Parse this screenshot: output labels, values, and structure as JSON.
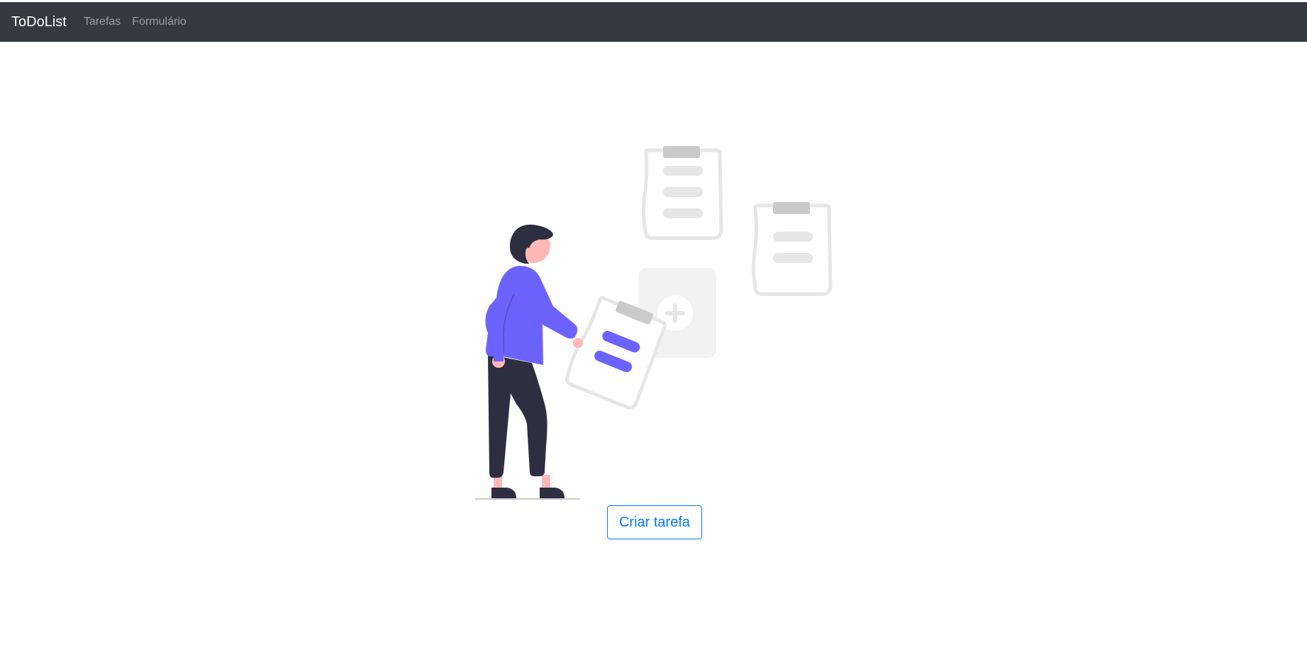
{
  "navbar": {
    "brand": "ToDoList",
    "links": [
      {
        "label": "Tarefas"
      },
      {
        "label": "Formulário"
      }
    ],
    "background": "#343a40"
  },
  "illustration": {
    "icons": [
      "person-icon",
      "clipboard-icon",
      "add-task-icon"
    ],
    "accent": "#6c63ff"
  },
  "main": {
    "create_button_label": "Criar tarefa",
    "button_color": "#007bff"
  }
}
